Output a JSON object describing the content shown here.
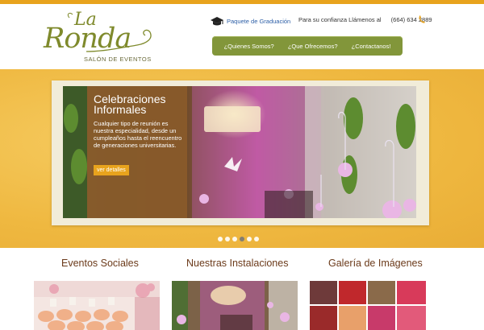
{
  "logo": {
    "line1": "La",
    "line2": "Ronda",
    "subtitle": "SALÓN DE EVENTOS"
  },
  "header": {
    "graduation_link": "Paquete de Graduación",
    "contact_text": "Para su confianza Llámenos al",
    "phone": "(664) 634 2889"
  },
  "nav": {
    "items": [
      "¿Quienes Somos?",
      "¿Que Ofrecemos?",
      "¿Contactanos!"
    ]
  },
  "hero": {
    "title": "Celebraciones Informales",
    "text": "Cualquier tipo de reunión es nuestra especialidad, desde un cumpleaños hasta el reencuentro de generaciones universitarias.",
    "button": "ver detalles",
    "slides": 6,
    "active_slide": 3
  },
  "sections": [
    {
      "title": "Eventos Sociales"
    },
    {
      "title": "Nuestras Instalaciones"
    },
    {
      "title": "Galería de Imágenes"
    }
  ],
  "colors": {
    "accent": "#e8a31d",
    "nav_green": "#82963a",
    "logo_green": "#7f8a2c",
    "section_title": "#6b3a1a"
  }
}
